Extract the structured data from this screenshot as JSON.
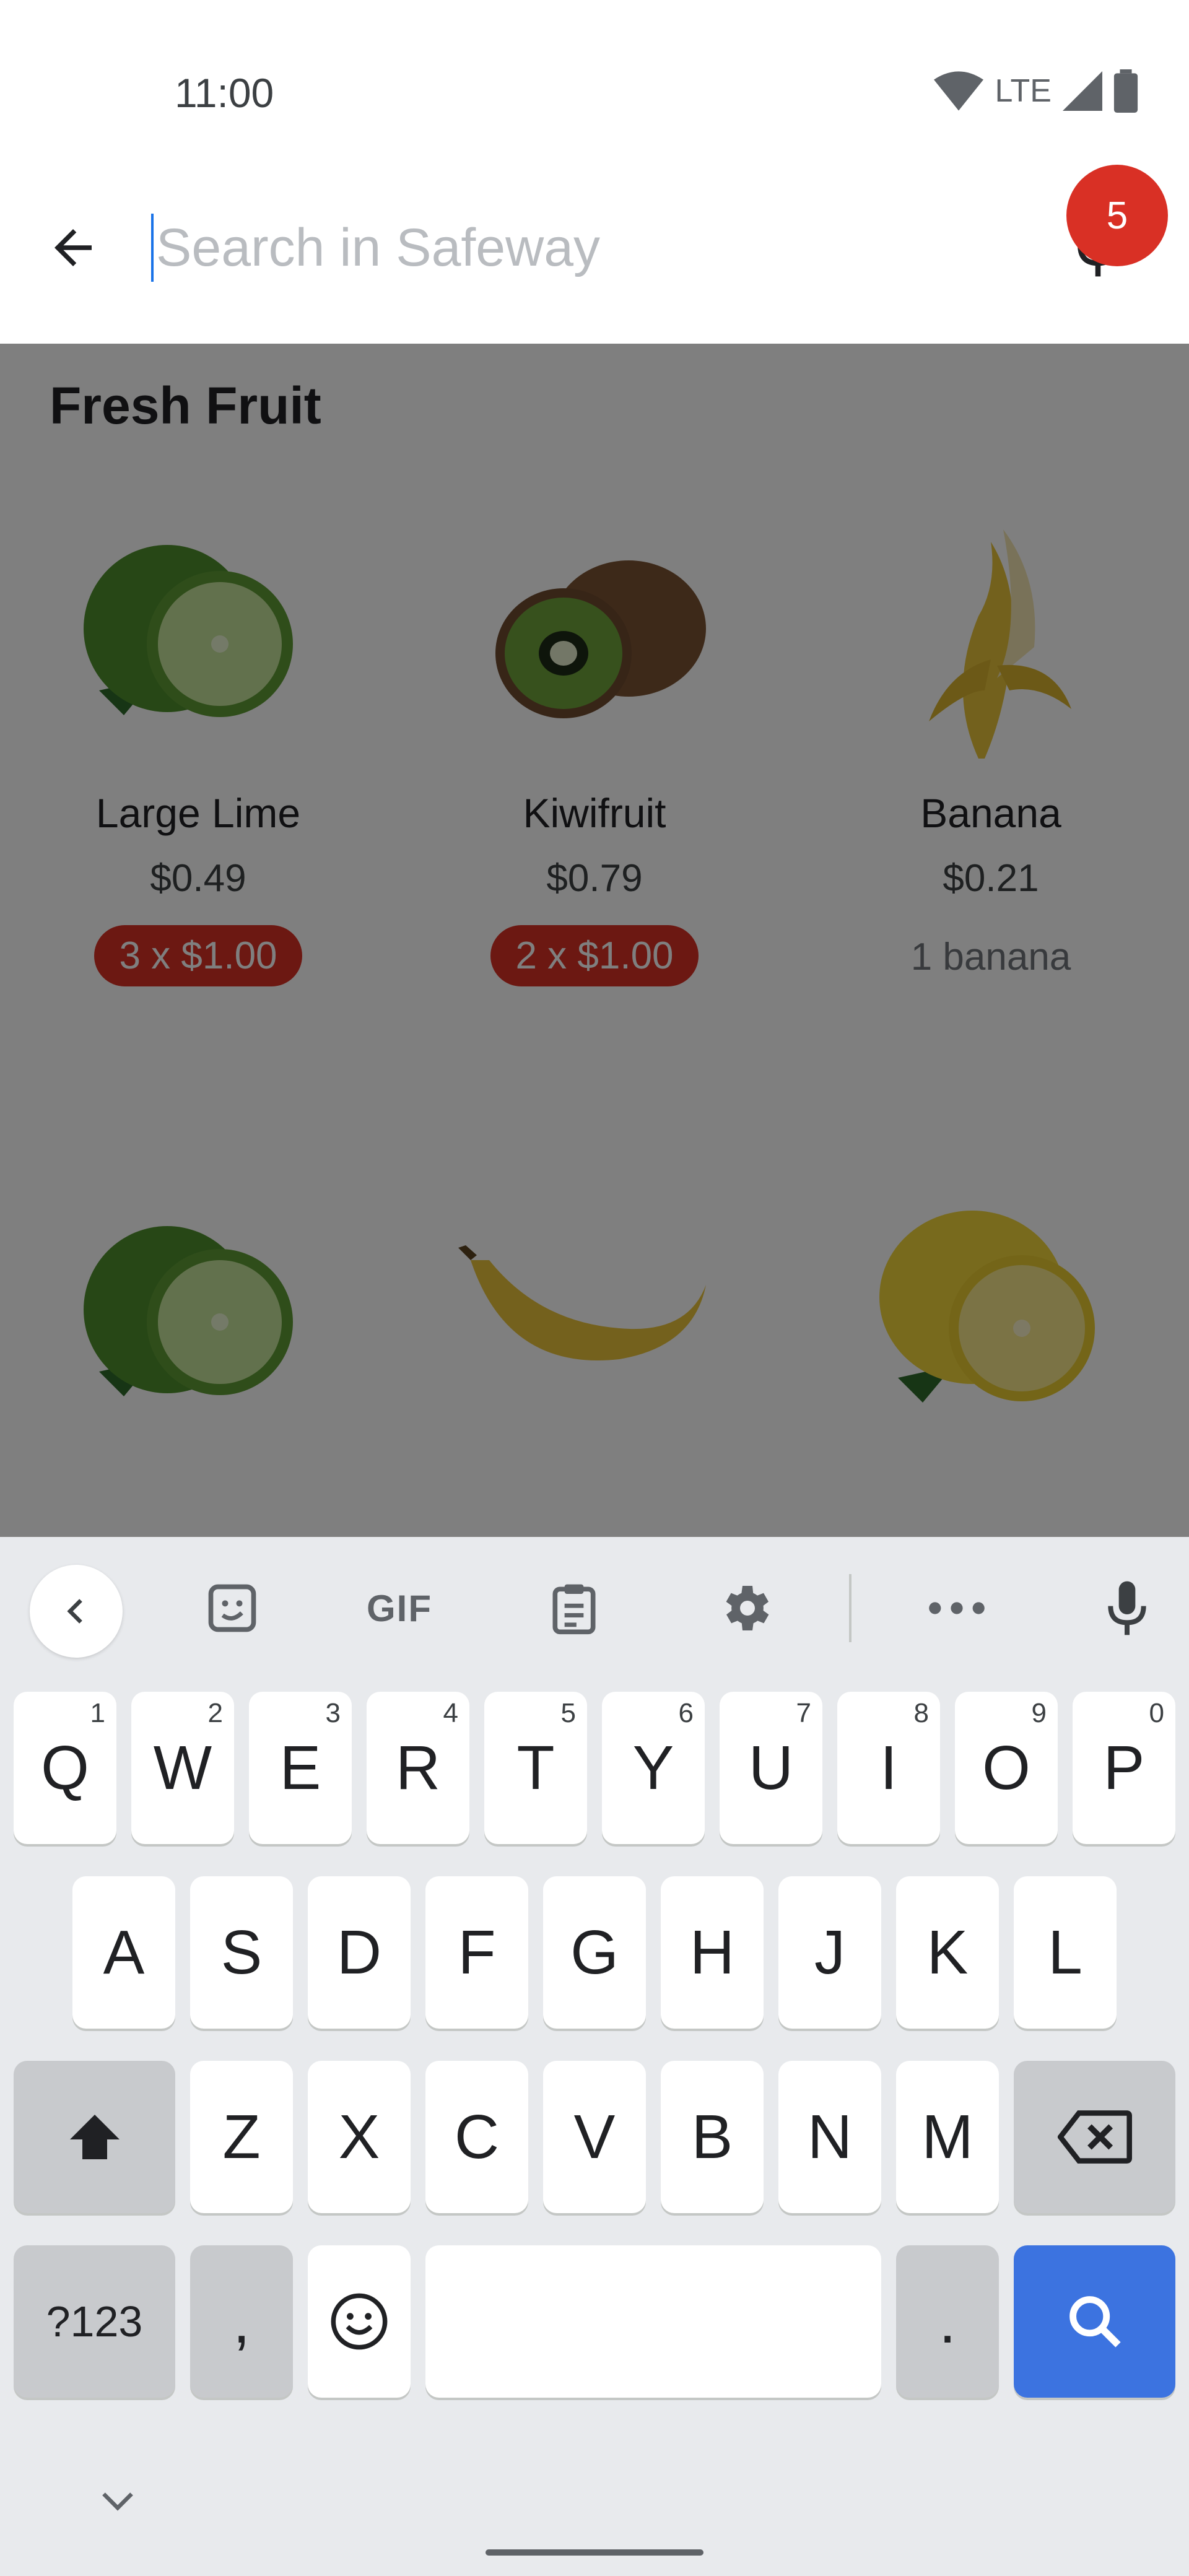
{
  "status_bar": {
    "time": "11:00",
    "network": "LTE"
  },
  "search": {
    "placeholder": "Search in Safeway"
  },
  "section": {
    "title": "Fresh Fruit"
  },
  "products": [
    {
      "name": "Large Lime",
      "price": "$0.49",
      "deal": "3 x $1.00",
      "image": "lime"
    },
    {
      "name": "Kiwifruit",
      "price": "$0.79",
      "deal": "2 x $1.00",
      "image": "kiwi"
    },
    {
      "name": "Banana",
      "price": "$0.21",
      "unit_note": "1 banana",
      "cart_quantity": "5",
      "image": "banana-peeled"
    },
    {
      "image": "lime"
    },
    {
      "image": "banana"
    },
    {
      "image": "lemon"
    }
  ],
  "keyboard": {
    "toolbar": {
      "gif_label": "GIF"
    },
    "row1": [
      {
        "key": "Q",
        "hint": "1"
      },
      {
        "key": "W",
        "hint": "2"
      },
      {
        "key": "E",
        "hint": "3"
      },
      {
        "key": "R",
        "hint": "4"
      },
      {
        "key": "T",
        "hint": "5"
      },
      {
        "key": "Y",
        "hint": "6"
      },
      {
        "key": "U",
        "hint": "7"
      },
      {
        "key": "I",
        "hint": "8"
      },
      {
        "key": "O",
        "hint": "9"
      },
      {
        "key": "P",
        "hint": "0"
      }
    ],
    "row2": [
      "A",
      "S",
      "D",
      "F",
      "G",
      "H",
      "J",
      "K",
      "L"
    ],
    "row3": [
      "Z",
      "X",
      "C",
      "V",
      "B",
      "N",
      "M"
    ],
    "symbols_key": "?123",
    "comma_key": ",",
    "period_key": "."
  },
  "colors": {
    "accent": "#d93025",
    "keyboard_action": "#3c73e0",
    "keyboard_bg": "#e8eaed"
  }
}
